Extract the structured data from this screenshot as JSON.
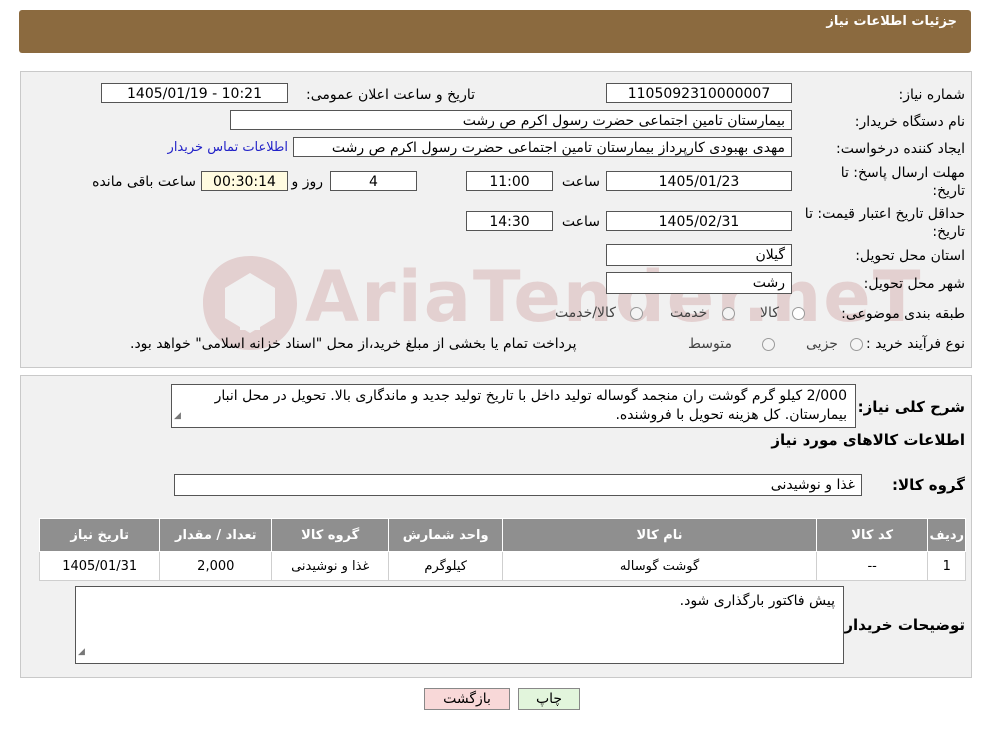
{
  "header": {
    "title": "جزئیات اطلاعات نیاز"
  },
  "form": {
    "need_number_label": "شماره نیاز:",
    "need_number": "1105092310000007",
    "announce_label": "تاریخ و ساعت اعلان عمومی:",
    "announce_value": "1405/01/19 - 10:21",
    "buyer_org_label": "نام دستگاه خریدار:",
    "buyer_org": "بیمارستان  تامین اجتماعی حضرت رسول اکرم ص رشت",
    "creator_label": "ایجاد کننده درخواست:",
    "creator": "مهدی بهبودی کارپرداز بیمارستان  تامین اجتماعی حضرت رسول اکرم ص رشت",
    "contact_link": "اطلاعات تماس خریدار",
    "deadline_label_1": "مهلت ارسال پاسخ: تا",
    "deadline_label_2": "تاریخ:",
    "deadline_date": "1405/01/23",
    "time_label": "ساعت",
    "deadline_time": "11:00",
    "days_value": "4",
    "days_label": "روز و",
    "remaining_time": "00:30:14",
    "remaining_label": "ساعت باقی مانده",
    "validity_label_1": "حداقل تاریخ اعتبار قیمت: تا",
    "validity_label_2": "تاریخ:",
    "validity_date": "1405/02/31",
    "validity_time_label": "ساعت",
    "validity_time": "14:30",
    "province_label": "استان محل تحویل:",
    "province": "گیلان",
    "city_label": "شهر محل تحویل:",
    "city": "رشت",
    "category_label": "طبقه بندی موضوعی:",
    "category_options": [
      "کالا",
      "خدمت",
      "کالا/خدمت"
    ],
    "process_label": "نوع فرآیند خرید :",
    "process_options": [
      "جزیی",
      "متوسط"
    ],
    "process_note": "پرداخت تمام یا بخشی از مبلغ خرید،از محل \"اسناد خزانه اسلامی\" خواهد بود."
  },
  "description": {
    "label": "شرح کلی نیاز:",
    "text": "2/000 کیلو گرم گوشت ران منجمد گوساله تولید داخل با تاریخ تولید جدید و ماندگاری بالا. تحویل در محل انبار بیمارستان. کل هزینه تحویل با فروشنده."
  },
  "items_section": {
    "title": "اطلاعات کالاهای مورد نیاز",
    "group_label": "گروه کالا:",
    "group_value": "غذا و نوشیدنی",
    "columns": [
      "ردیف",
      "کد کالا",
      "نام کالا",
      "واحد شمارش",
      "گروه کالا",
      "تعداد / مقدار",
      "تاریخ نیاز"
    ],
    "rows": [
      [
        "1",
        "--",
        "گوشت گوساله",
        "کیلوگرم",
        "غذا و نوشیدنی",
        "2,000",
        "1405/01/31"
      ]
    ]
  },
  "buyer_notes": {
    "label": "توضیحات خریدار:",
    "text": "پیش فاکتور بارگذاری شود."
  },
  "buttons": {
    "print": "چاپ",
    "back": "بازگشت"
  },
  "watermark": {
    "text": "AriaTender.neT"
  },
  "colors": {
    "header": "#8b6a3f",
    "link": "#2323c8",
    "table_header": "#8f8f8f",
    "back_button": "#f8d8d8",
    "print_button": "#e2f5dc"
  }
}
